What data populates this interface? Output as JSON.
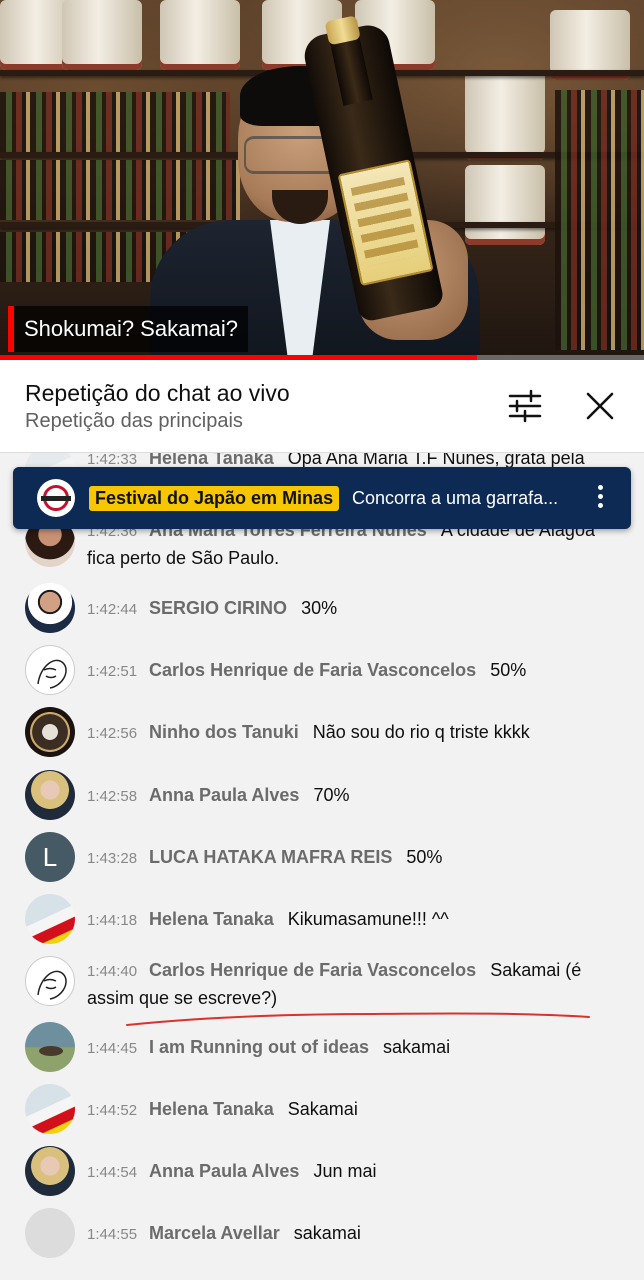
{
  "video": {
    "caption": "Shokumai? Sakamai?",
    "progress_percent": 74
  },
  "header": {
    "title": "Repetição do chat ao vivo",
    "subtitle": "Repetição das principais"
  },
  "pinned": {
    "tag": "Festival do Japão em Minas",
    "text": "Concorra a uma garrafa..."
  },
  "messages": [
    {
      "time": "1:42:33",
      "author": "Helena Tanaka",
      "text": "Opa Ana Maria T.F Nunes, grata pela"
    },
    {
      "time": "1:42:36",
      "author": "Ana Maria Torres Ferreira Nunes",
      "text": "A cidade de Alagoa fica perto de São Paulo."
    },
    {
      "time": "1:42:44",
      "author": "SERGIO CIRINO",
      "text": "30%"
    },
    {
      "time": "1:42:51",
      "author": "Carlos Henrique de Faria Vasconcelos",
      "text": "50%"
    },
    {
      "time": "1:42:56",
      "author": "Ninho dos Tanuki",
      "text": "Não sou do rio q triste kkkk"
    },
    {
      "time": "1:42:58",
      "author": "Anna Paula Alves",
      "text": "70%"
    },
    {
      "time": "1:43:28",
      "author": "LUCA HATAKA MAFRA REIS",
      "text": "50%",
      "avatar_letter": "L"
    },
    {
      "time": "1:44:18",
      "author": "Helena Tanaka",
      "text": "Kikumasamune!!! ^^"
    },
    {
      "time": "1:44:40",
      "author": "Carlos Henrique de Faria Vasconcelos",
      "text": "Sakamai (é assim que se escreve?)"
    },
    {
      "time": "1:44:45",
      "author": "I am Running out of ideas",
      "text": "sakamai"
    },
    {
      "time": "1:44:52",
      "author": "Helena Tanaka",
      "text": "Sakamai"
    },
    {
      "time": "1:44:54",
      "author": "Anna Paula Alves",
      "text": "Jun mai"
    },
    {
      "time": "1:44:55",
      "author": "Marcela Avellar",
      "text": "sakamai"
    }
  ],
  "colors": {
    "accent_red": "#ff0000",
    "pinned_bg": "#0d2a54",
    "pinned_tag": "#f7c600",
    "annotation_red": "#d9342b"
  }
}
